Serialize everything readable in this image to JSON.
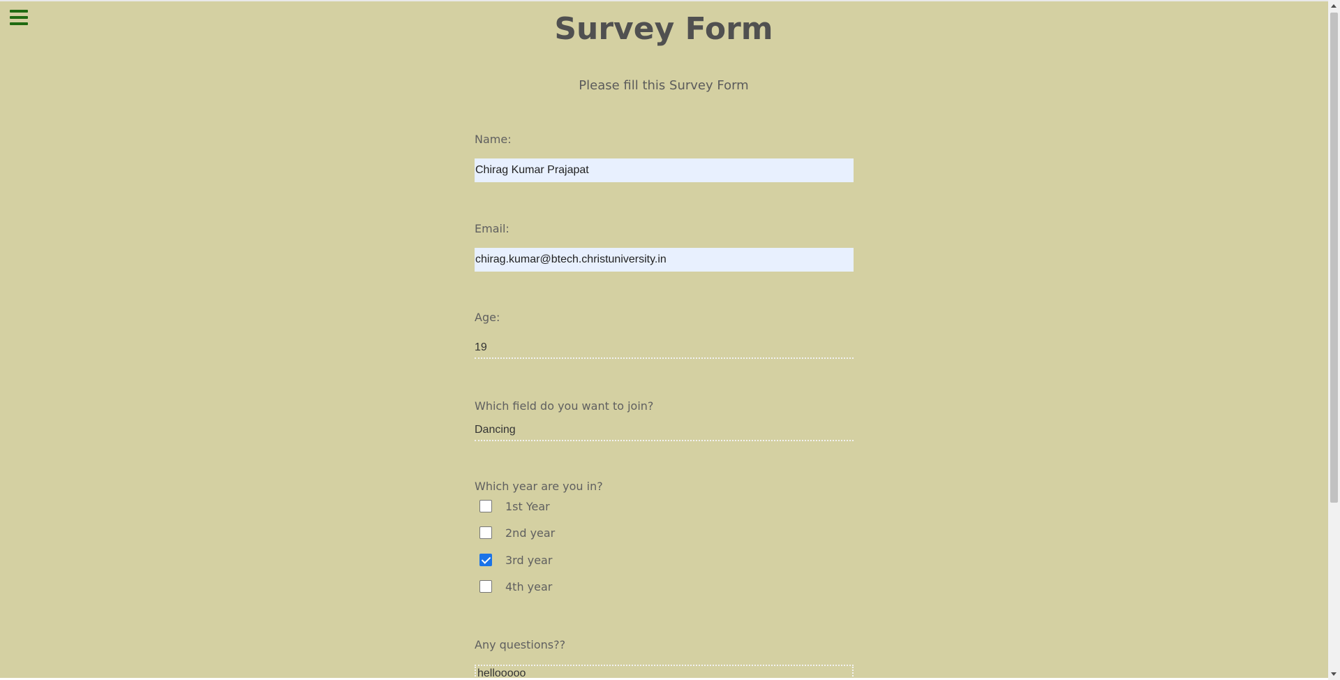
{
  "header": {
    "title": "Survey Form",
    "subtitle": "Please fill this Survey Form",
    "menu_icon": "hamburger-menu-icon"
  },
  "form": {
    "name": {
      "label": "Name:",
      "value": "Chirag Kumar Prajapat"
    },
    "email": {
      "label": "Email:",
      "value": "chirag.kumar@btech.christuniversity.in"
    },
    "age": {
      "label": "Age:",
      "value": "19"
    },
    "field": {
      "label": "Which field do you want to join?",
      "value": "Dancing"
    },
    "year": {
      "label": "Which year are you in?",
      "options": [
        {
          "label": "1st Year",
          "checked": false
        },
        {
          "label": "2nd year",
          "checked": false
        },
        {
          "label": "3rd year",
          "checked": true
        },
        {
          "label": "4th year",
          "checked": false
        }
      ]
    },
    "questions": {
      "label": "Any questions??",
      "value": "hellooooo"
    }
  },
  "colors": {
    "background": "#d4d0a2",
    "menu_icon": "#1f6a11",
    "autofill_input": "#e8f0fe",
    "checkbox_checked": "#1a73e8"
  }
}
